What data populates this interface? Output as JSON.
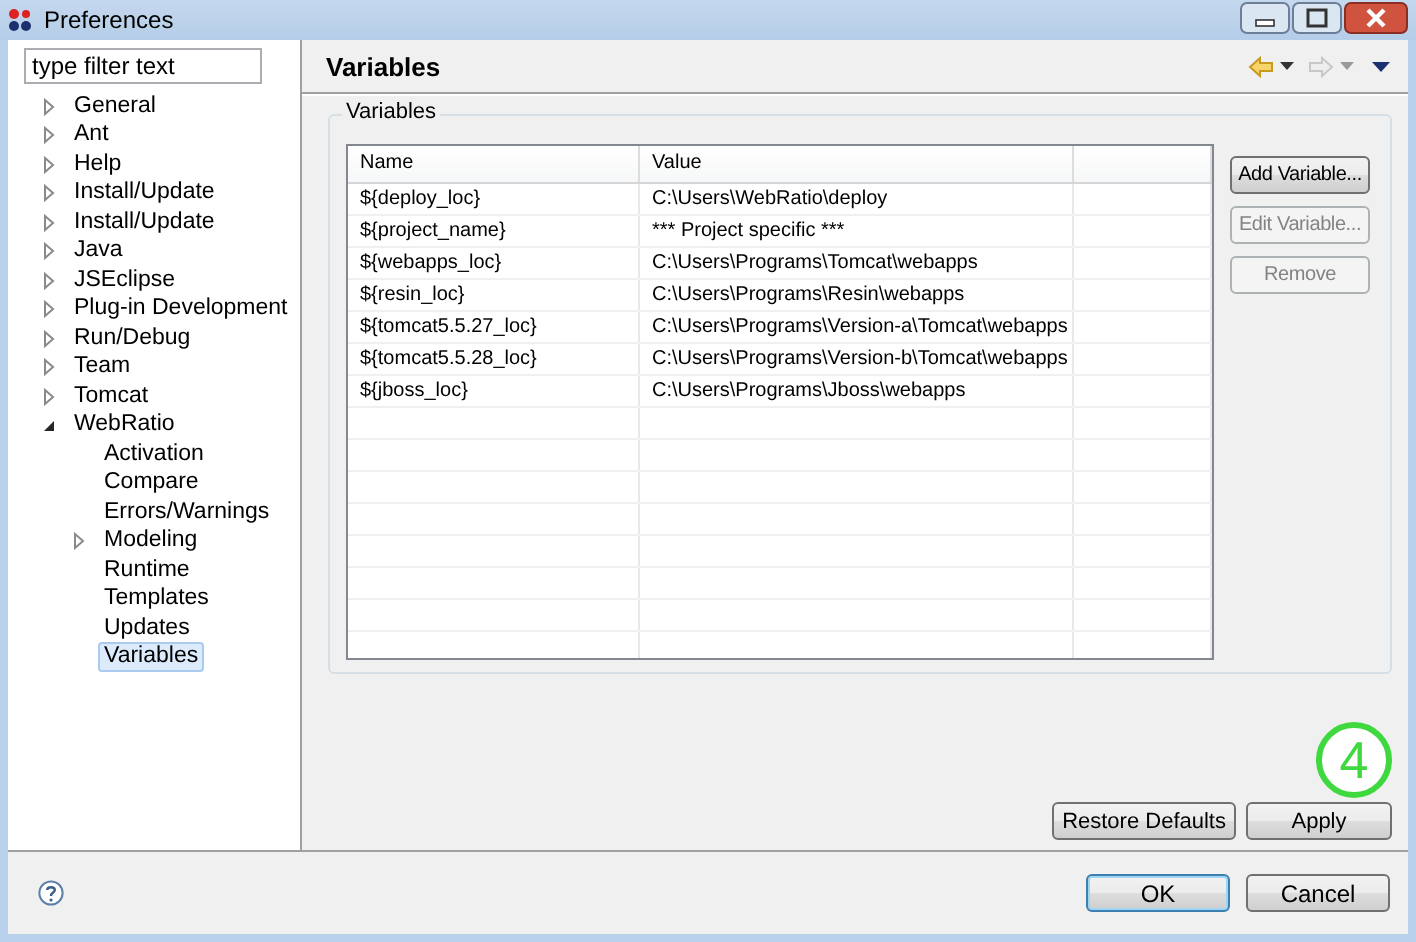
{
  "window": {
    "title": "Preferences"
  },
  "filter": {
    "placeholder": "type filter text"
  },
  "tree": [
    {
      "label": "General",
      "kind": "folder",
      "expanded": false,
      "selected": false
    },
    {
      "label": "Ant",
      "kind": "folder",
      "expanded": false,
      "selected": false
    },
    {
      "label": "Help",
      "kind": "folder",
      "expanded": false,
      "selected": false
    },
    {
      "label": "Install/Update",
      "kind": "folder",
      "expanded": false,
      "selected": false
    },
    {
      "label": "Install/Update",
      "kind": "folder",
      "expanded": false,
      "selected": false
    },
    {
      "label": "Java",
      "kind": "folder",
      "expanded": false,
      "selected": false
    },
    {
      "label": "JSEclipse",
      "kind": "folder",
      "expanded": false,
      "selected": false
    },
    {
      "label": "Plug-in Development",
      "kind": "folder",
      "expanded": false,
      "selected": false
    },
    {
      "label": "Run/Debug",
      "kind": "folder",
      "expanded": false,
      "selected": false
    },
    {
      "label": "Team",
      "kind": "folder",
      "expanded": false,
      "selected": false
    },
    {
      "label": "Tomcat",
      "kind": "folder",
      "expanded": false,
      "selected": false
    },
    {
      "label": "WebRatio",
      "kind": "folder",
      "expanded": true,
      "selected": false,
      "children": [
        {
          "label": "Activation",
          "kind": "leaf",
          "selected": false
        },
        {
          "label": "Compare",
          "kind": "leaf",
          "selected": false
        },
        {
          "label": "Errors/Warnings",
          "kind": "leaf",
          "selected": false
        },
        {
          "label": "Modeling",
          "kind": "folder",
          "expanded": false,
          "selected": false
        },
        {
          "label": "Runtime",
          "kind": "leaf",
          "selected": false
        },
        {
          "label": "Templates",
          "kind": "leaf",
          "selected": false
        },
        {
          "label": "Updates",
          "kind": "leaf",
          "selected": false
        },
        {
          "label": "Variables",
          "kind": "leaf",
          "selected": true
        }
      ]
    }
  ],
  "page": {
    "title": "Variables"
  },
  "group": {
    "title": "Variables"
  },
  "table": {
    "columns": [
      "Name",
      "Value"
    ],
    "rows": [
      [
        "${deploy_loc}",
        "C:\\Users\\WebRatio\\deploy"
      ],
      [
        "${project_name}",
        "*** Project specific ***"
      ],
      [
        "${webapps_loc}",
        "C:\\Users\\Programs\\Tomcat\\webapps"
      ],
      [
        "${resin_loc}",
        "C:\\Users\\Programs\\Resin\\webapps"
      ],
      [
        "${tomcat5.5.27_loc}",
        "C:\\Users\\Programs\\Version-a\\Tomcat\\webapps"
      ],
      [
        "${tomcat5.5.28_loc}",
        "C:\\Users\\Programs\\Version-b\\Tomcat\\webapps"
      ],
      [
        "${jboss_loc}",
        "C:\\Users\\Programs\\Jboss\\webapps"
      ]
    ]
  },
  "side_buttons": [
    {
      "label": "Add Variable...",
      "disabled": false
    },
    {
      "label": "Edit Variable...",
      "disabled": true
    },
    {
      "label": "Remove",
      "disabled": true
    }
  ],
  "page_buttons": [
    {
      "label": "Restore Defaults"
    },
    {
      "label": "Apply"
    }
  ],
  "callout": {
    "label": "4"
  },
  "dialog_buttons": [
    {
      "label": "OK",
      "default": true
    },
    {
      "label": "Cancel",
      "default": false
    }
  ]
}
